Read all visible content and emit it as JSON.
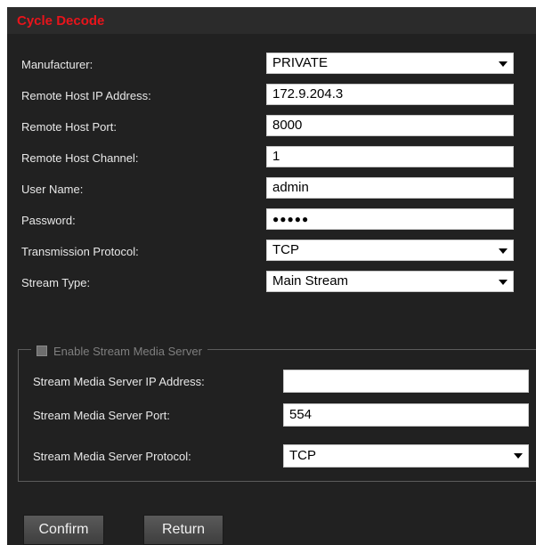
{
  "panel": {
    "title": "Cycle Decode"
  },
  "form": {
    "manufacturer": {
      "label": "Manufacturer:",
      "value": "PRIVATE"
    },
    "remote_host_ip": {
      "label": "Remote Host IP Address:",
      "value": "172.9.204.3"
    },
    "remote_host_port": {
      "label": "Remote Host Port:",
      "value": "8000"
    },
    "remote_host_channel": {
      "label": "Remote Host Channel:",
      "value": "1"
    },
    "user_name": {
      "label": "User Name:",
      "value": "admin"
    },
    "password": {
      "label": "Password:",
      "value": "●●●●●"
    },
    "transmission_protocol": {
      "label": "Transmission Protocol:",
      "value": "TCP"
    },
    "stream_type": {
      "label": "Stream Type:",
      "value": "Main Stream"
    }
  },
  "stream_media": {
    "enable_label": "Enable Stream Media Server",
    "enabled": false,
    "ip": {
      "label": "Stream Media Server IP Address:",
      "value": ""
    },
    "port": {
      "label": "Stream Media Server Port:",
      "value": "554"
    },
    "protocol": {
      "label": "Stream Media Server Protocol:",
      "value": "TCP"
    }
  },
  "buttons": {
    "confirm": "Confirm",
    "return": "Return"
  },
  "colors": {
    "title": "#e8141b",
    "panel_background": "#212121"
  }
}
